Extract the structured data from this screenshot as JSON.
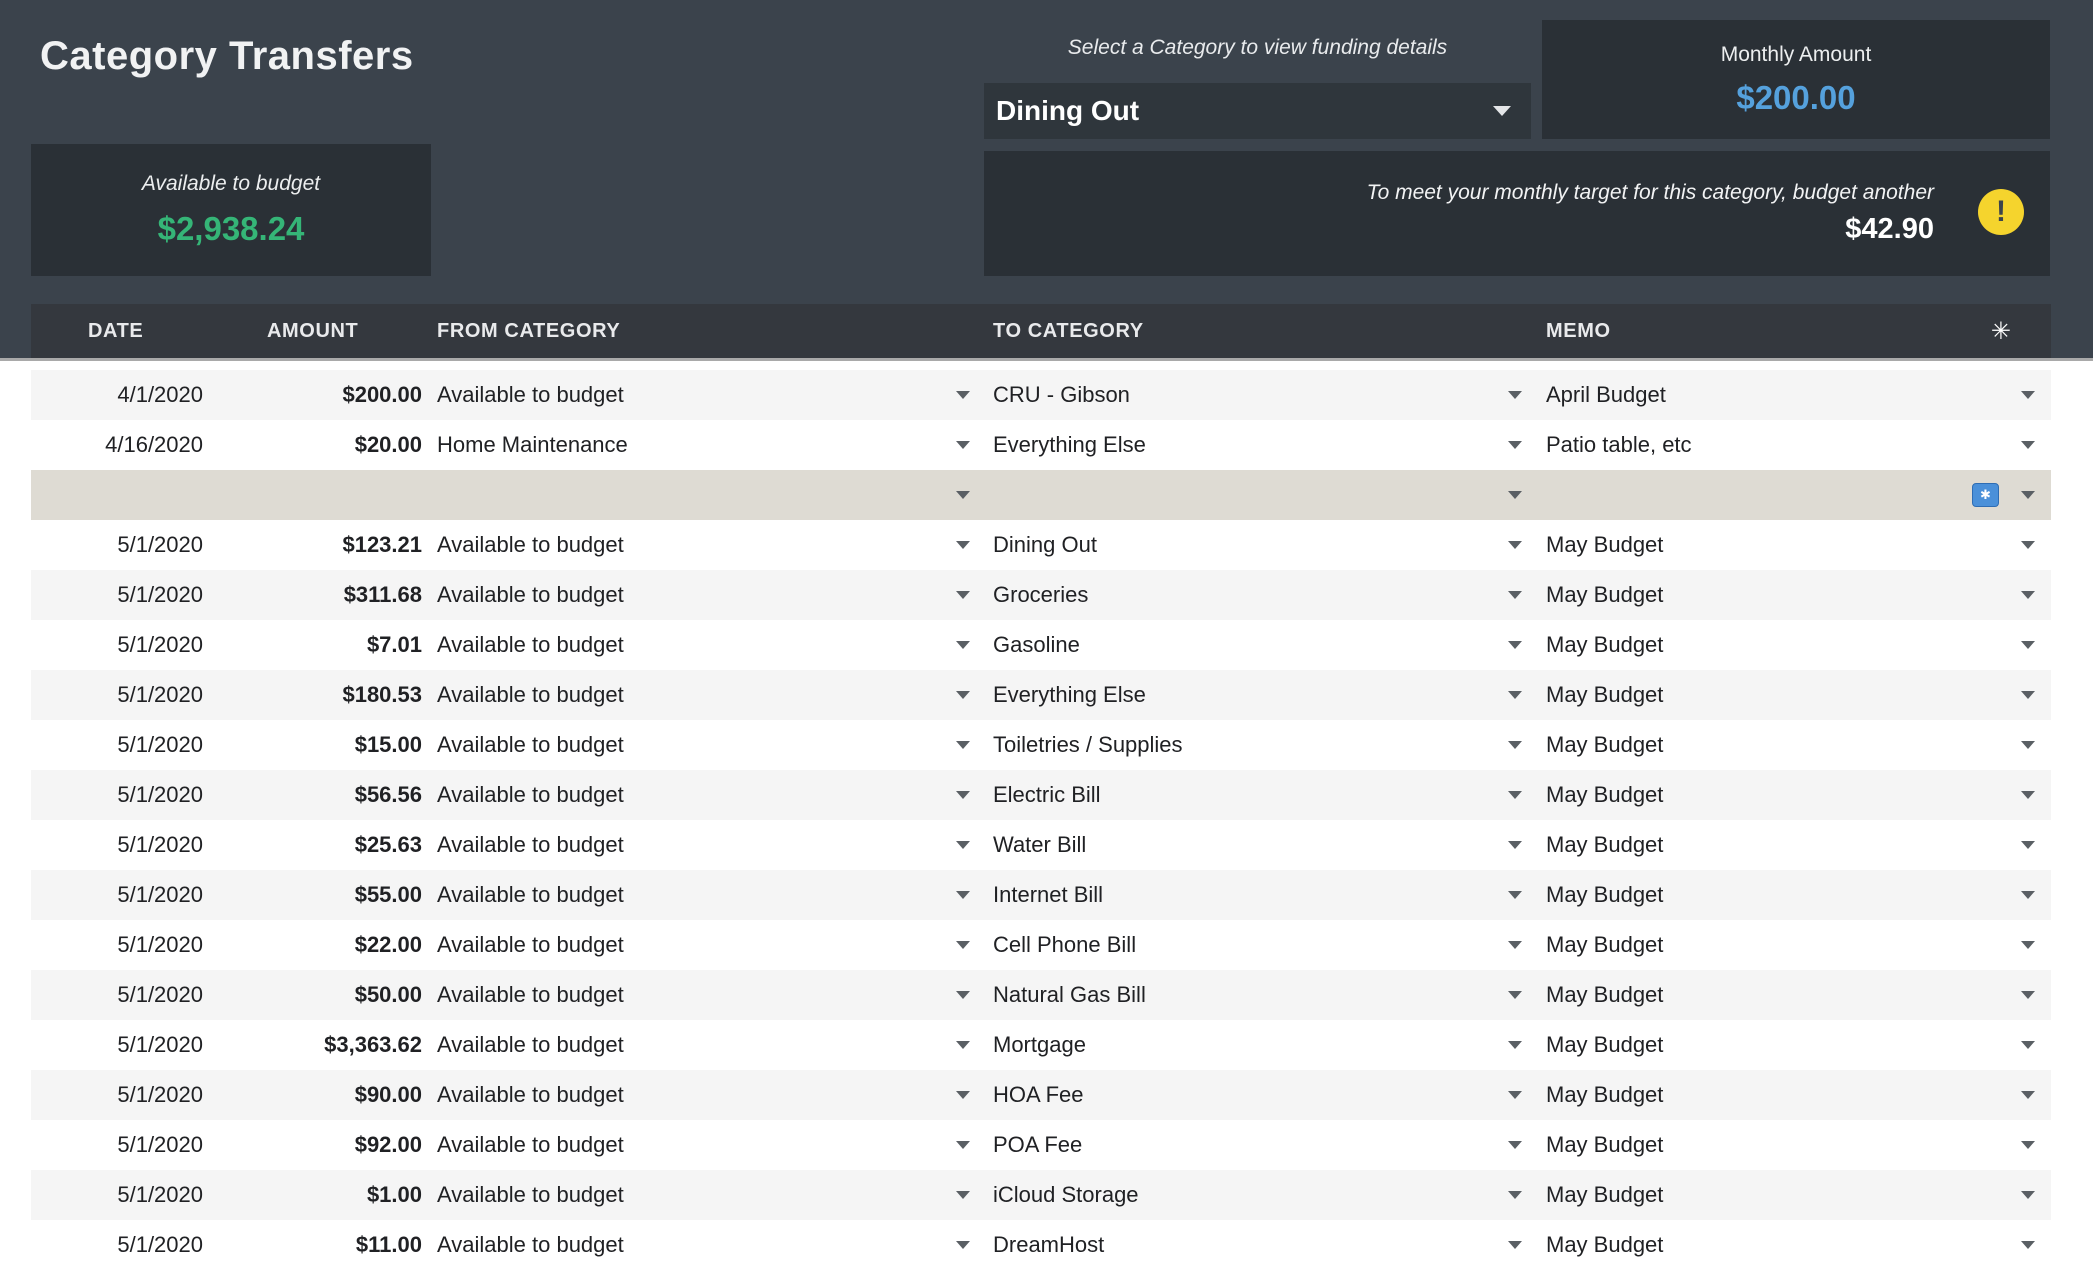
{
  "page": {
    "title": "Category Transfers"
  },
  "summary": {
    "available_label": "Available to budget",
    "available_value": "$2,938.24",
    "select_hint": "Select a Category to view funding details",
    "selected_category": "Dining Out",
    "monthly_label": "Monthly Amount",
    "monthly_value": "$200.00",
    "target_message": "To meet your monthly target for this category, budget another",
    "target_amount": "$42.90"
  },
  "icons": {
    "alert": "!",
    "header_asterisk": "✳",
    "validation_badge": "✱"
  },
  "table": {
    "headers": {
      "date": "DATE",
      "amount": "AMOUNT",
      "from": "FROM CATEGORY",
      "to": "TO CATEGORY",
      "memo": "MEMO"
    },
    "rows": [
      {
        "date": "4/1/2020",
        "amount": "$200.00",
        "from": "Available to budget",
        "to": "CRU - Gibson",
        "memo": "April Budget"
      },
      {
        "date": "4/16/2020",
        "amount": "$20.00",
        "from": "Home Maintenance",
        "to": "Everything Else",
        "memo": "Patio table, etc"
      },
      {
        "date": "",
        "amount": "",
        "from": "",
        "to": "",
        "memo": "",
        "empty": true
      },
      {
        "date": "5/1/2020",
        "amount": "$123.21",
        "from": "Available to budget",
        "to": "Dining Out",
        "memo": "May Budget"
      },
      {
        "date": "5/1/2020",
        "amount": "$311.68",
        "from": "Available to budget",
        "to": "Groceries",
        "memo": "May Budget"
      },
      {
        "date": "5/1/2020",
        "amount": "$7.01",
        "from": "Available to budget",
        "to": "Gasoline",
        "memo": "May Budget"
      },
      {
        "date": "5/1/2020",
        "amount": "$180.53",
        "from": "Available to budget",
        "to": "Everything Else",
        "memo": "May Budget"
      },
      {
        "date": "5/1/2020",
        "amount": "$15.00",
        "from": "Available to budget",
        "to": "Toiletries / Supplies",
        "memo": "May Budget"
      },
      {
        "date": "5/1/2020",
        "amount": "$56.56",
        "from": "Available to budget",
        "to": "Electric Bill",
        "memo": "May Budget"
      },
      {
        "date": "5/1/2020",
        "amount": "$25.63",
        "from": "Available to budget",
        "to": "Water Bill",
        "memo": "May Budget"
      },
      {
        "date": "5/1/2020",
        "amount": "$55.00",
        "from": "Available to budget",
        "to": "Internet Bill",
        "memo": "May Budget"
      },
      {
        "date": "5/1/2020",
        "amount": "$22.00",
        "from": "Available to budget",
        "to": "Cell Phone Bill",
        "memo": "May Budget"
      },
      {
        "date": "5/1/2020",
        "amount": "$50.00",
        "from": "Available to budget",
        "to": "Natural Gas Bill",
        "memo": "May Budget"
      },
      {
        "date": "5/1/2020",
        "amount": "$3,363.62",
        "from": "Available to budget",
        "to": "Mortgage",
        "memo": "May Budget"
      },
      {
        "date": "5/1/2020",
        "amount": "$90.00",
        "from": "Available to budget",
        "to": "HOA Fee",
        "memo": "May Budget"
      },
      {
        "date": "5/1/2020",
        "amount": "$92.00",
        "from": "Available to budget",
        "to": "POA Fee",
        "memo": "May Budget"
      },
      {
        "date": "5/1/2020",
        "amount": "$1.00",
        "from": "Available to budget",
        "to": "iCloud Storage",
        "memo": "May Budget"
      },
      {
        "date": "5/1/2020",
        "amount": "$11.00",
        "from": "Available to budget",
        "to": "DreamHost",
        "memo": "May Budget"
      }
    ]
  },
  "colors": {
    "background_dark": "#3b434c",
    "panel_dark": "#2a3036",
    "table_header": "#34383e",
    "accent_green": "#35b577",
    "accent_blue": "#55a1dd",
    "alert_yellow": "#f5d42d",
    "row_stripe": "#f5f5f5",
    "empty_row_beige": "#dedbd3",
    "validation_blue": "#4a90d9"
  }
}
